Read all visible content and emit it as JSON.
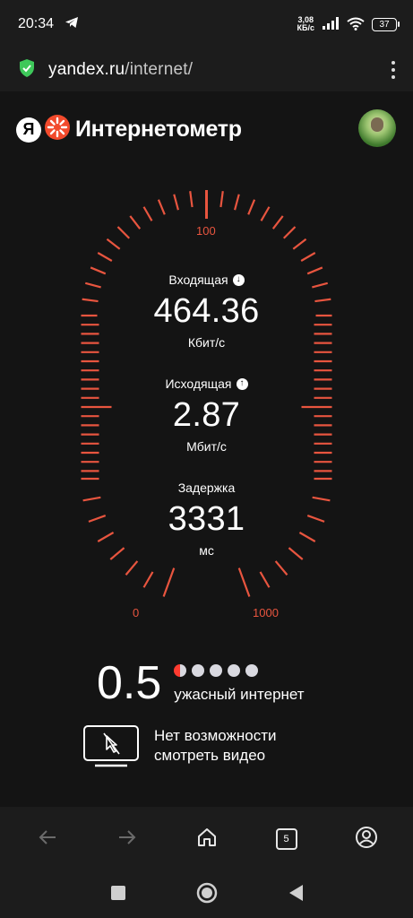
{
  "status_bar": {
    "time": "20:34",
    "net_speed_value": "3,08",
    "net_speed_unit": "КБ/с",
    "battery": "37"
  },
  "browser": {
    "url_domain": "yandex.ru",
    "url_path": "/internet/",
    "tab_count": "5"
  },
  "header": {
    "logo_letter": "Я",
    "brand": "Интернетометр"
  },
  "gauge": {
    "scale_min": "0",
    "scale_mid": "100",
    "scale_max": "1000"
  },
  "metrics": {
    "download": {
      "label": "Входящая",
      "value": "464.36",
      "unit": "Кбит/с"
    },
    "upload": {
      "label": "Исходящая",
      "value": "2.87",
      "unit": "Мбит/с"
    },
    "latency": {
      "label": "Задержка",
      "value": "3331",
      "unit": "мс"
    }
  },
  "rating": {
    "score": "0.5",
    "max_dots": 5,
    "description": "ужасный интернет"
  },
  "video_note": {
    "line1": "Нет возможности",
    "line2": "смотреть видео"
  },
  "colors": {
    "accent": "#e8553f",
    "background": "#141414",
    "bar": "#1c1c1c"
  }
}
